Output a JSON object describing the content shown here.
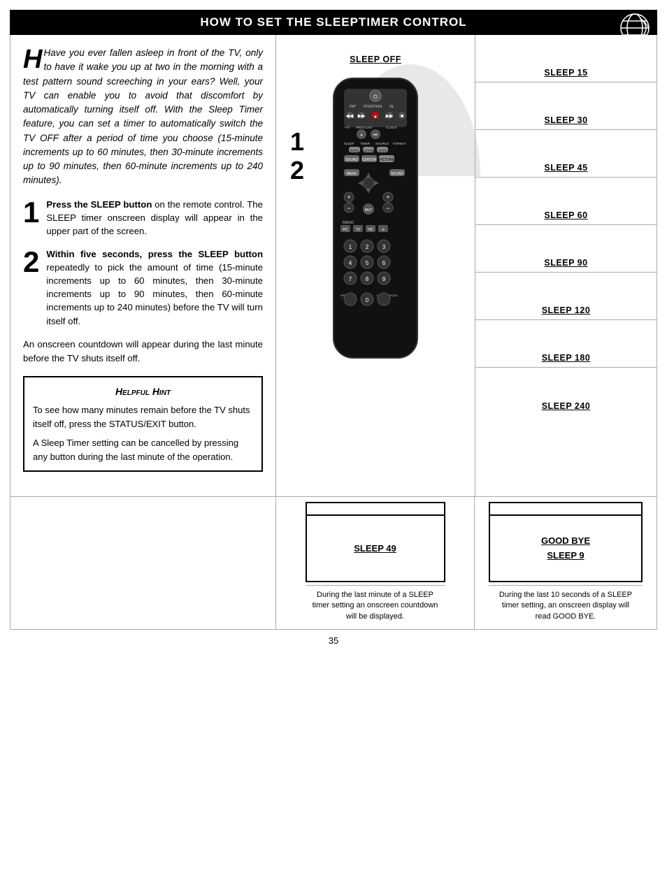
{
  "header": {
    "title": "How to Set the Sleeptimer Control"
  },
  "intro": {
    "text": "Have you ever fallen asleep in front of the TV, only to have it wake you up at two in the morning with a test pattern sound screeching in your ears?  Well, your TV can enable you to avoid that discomfort by automatically turning itself off. With the Sleep Timer feature, you can set a timer to automatically switch the TV OFF after a period of time you choose (15-minute increments up to 60 minutes, then 30-minute increments up to 90 minutes, then 60-minute increments up to 240 minutes)."
  },
  "steps": [
    {
      "num": "1",
      "text": "Press the SLEEP button on the remote control.  The SLEEP timer onscreen display will appear in the upper part of the screen."
    },
    {
      "num": "2",
      "text": "Within five seconds, press the SLEEP button repeatedly to pick the amount of time (15-minute increments up to 60 minutes, then 30-minute increments up to 90 minutes, then 60-minute increments up to 240 minutes) before the TV will turn itself off."
    }
  ],
  "countdown_note": "An onscreen countdown will appear during the last minute before the TV shuts itself off.",
  "helpful_hint": {
    "title": "Helpful Hint",
    "items": [
      "To see how many minutes remain before the TV shuts itself off, press the STATUS/EXIT button.",
      "A Sleep Timer setting can be cancelled by pressing any button during the last minute of the operation."
    ]
  },
  "sleep_labels": [
    "SLEEP 15",
    "SLEEP 30",
    "SLEEP 45",
    "SLEEP 60",
    "SLEEP 90",
    "SLEEP 120",
    "SLEEP 180",
    "SLEEP 240"
  ],
  "sleep_off_label": "SLEEP OFF",
  "bottom": {
    "center_label": "SLEEP 49",
    "center_note": "During the last minute of a SLEEP timer setting an onscreen countdown will be displayed.",
    "right_good_bye": "GOOD BYE",
    "right_sleep_9": "SLEEP 9",
    "right_note": "During the last 10 seconds of a SLEEP timer setting, an onscreen display will read GOOD BYE."
  },
  "page_number": "35"
}
